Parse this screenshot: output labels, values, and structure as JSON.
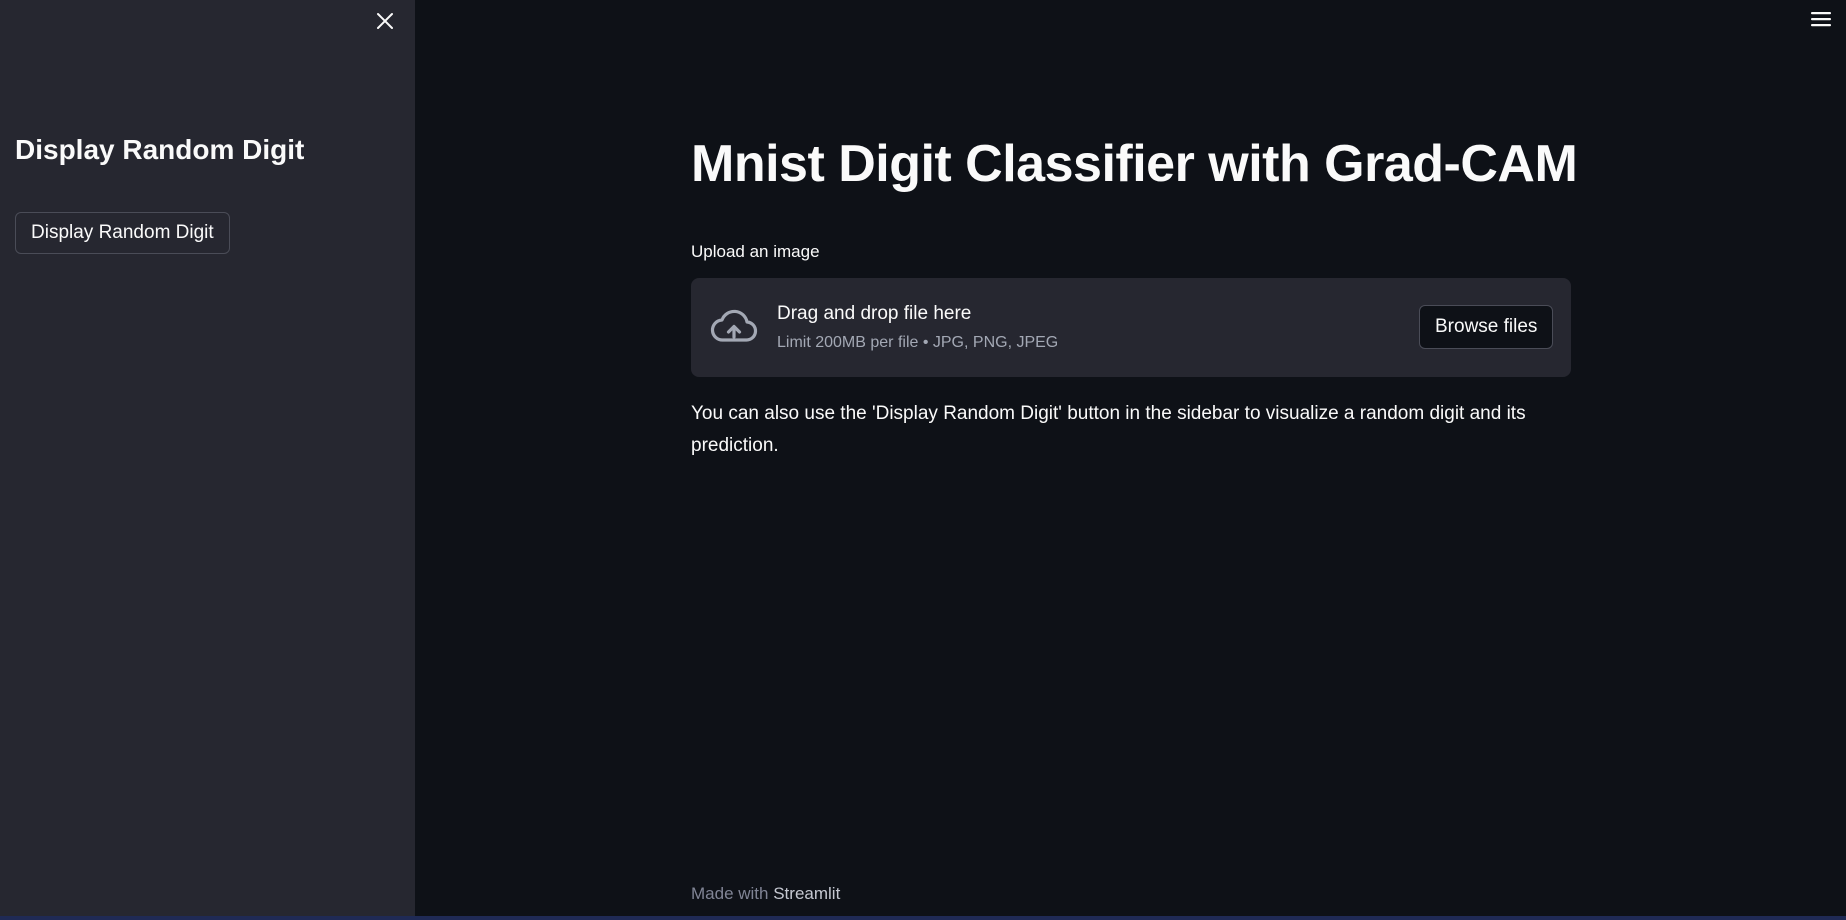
{
  "sidebar": {
    "close_icon": "close-icon",
    "title": "Display Random Digit",
    "button_label": "Display Random Digit"
  },
  "header": {
    "menu_icon": "hamburger-menu-icon"
  },
  "main": {
    "title": "Mnist Digit Classifier with Grad-CAM",
    "uploader": {
      "label": "Upload an image",
      "icon": "cloud-upload-icon",
      "primary_text": "Drag and drop file here",
      "secondary_text": "Limit 200MB per file • JPG, PNG, JPEG",
      "browse_label": "Browse files"
    },
    "info_text": "You can also use the 'Display Random Digit' button in the sidebar to visualize a random digit and its prediction."
  },
  "footer": {
    "prefix": "Made with",
    "link": "Streamlit"
  },
  "colors": {
    "background": "#0e1117",
    "sidebar": "#262730",
    "text": "#fafafa",
    "muted_text": "#a3a8b4",
    "border": "#4a4c57"
  }
}
